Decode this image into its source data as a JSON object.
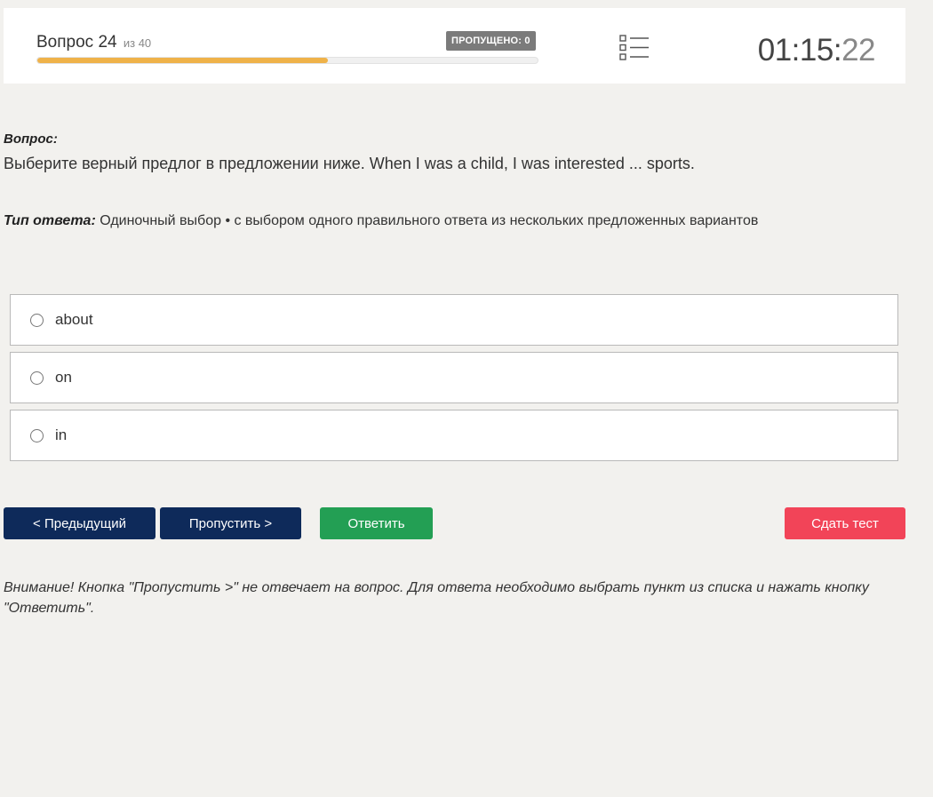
{
  "header": {
    "question_prefix": "Вопрос 24",
    "question_of": "из 40",
    "skipped_badge": "ПРОПУЩЕНО: 0",
    "progress_fraction": 0.58,
    "timer_main": "01:15:",
    "timer_seconds": "22",
    "list_icon": "question-list-icon"
  },
  "question": {
    "label": "Вопрос:",
    "text": "Выберите верный предлог в предложении ниже. When I was a child, I was interested ... sports."
  },
  "answer_type": {
    "label": "Тип ответа:",
    "text": " Одиночный выбор • с выбором одного правильного ответа из нескольких предложенных вариантов"
  },
  "options": [
    {
      "label": "about",
      "selected": false
    },
    {
      "label": "on",
      "selected": false
    },
    {
      "label": "in",
      "selected": false
    }
  ],
  "buttons": {
    "prev": "< Предыдущий",
    "skip": "Пропустить >",
    "answer": "Ответить",
    "submit": "Сдать тест"
  },
  "colors": {
    "progress": "#efb249",
    "nav_button": "#0e2a5a",
    "answer_button": "#239f54",
    "submit_button": "#f24458"
  },
  "warning": "Внимание! Кнопка \"Пропустить >\" не отвечает на вопрос. Для ответа необходимо выбрать пункт из списка и нажать кнопку \"Ответить\"."
}
